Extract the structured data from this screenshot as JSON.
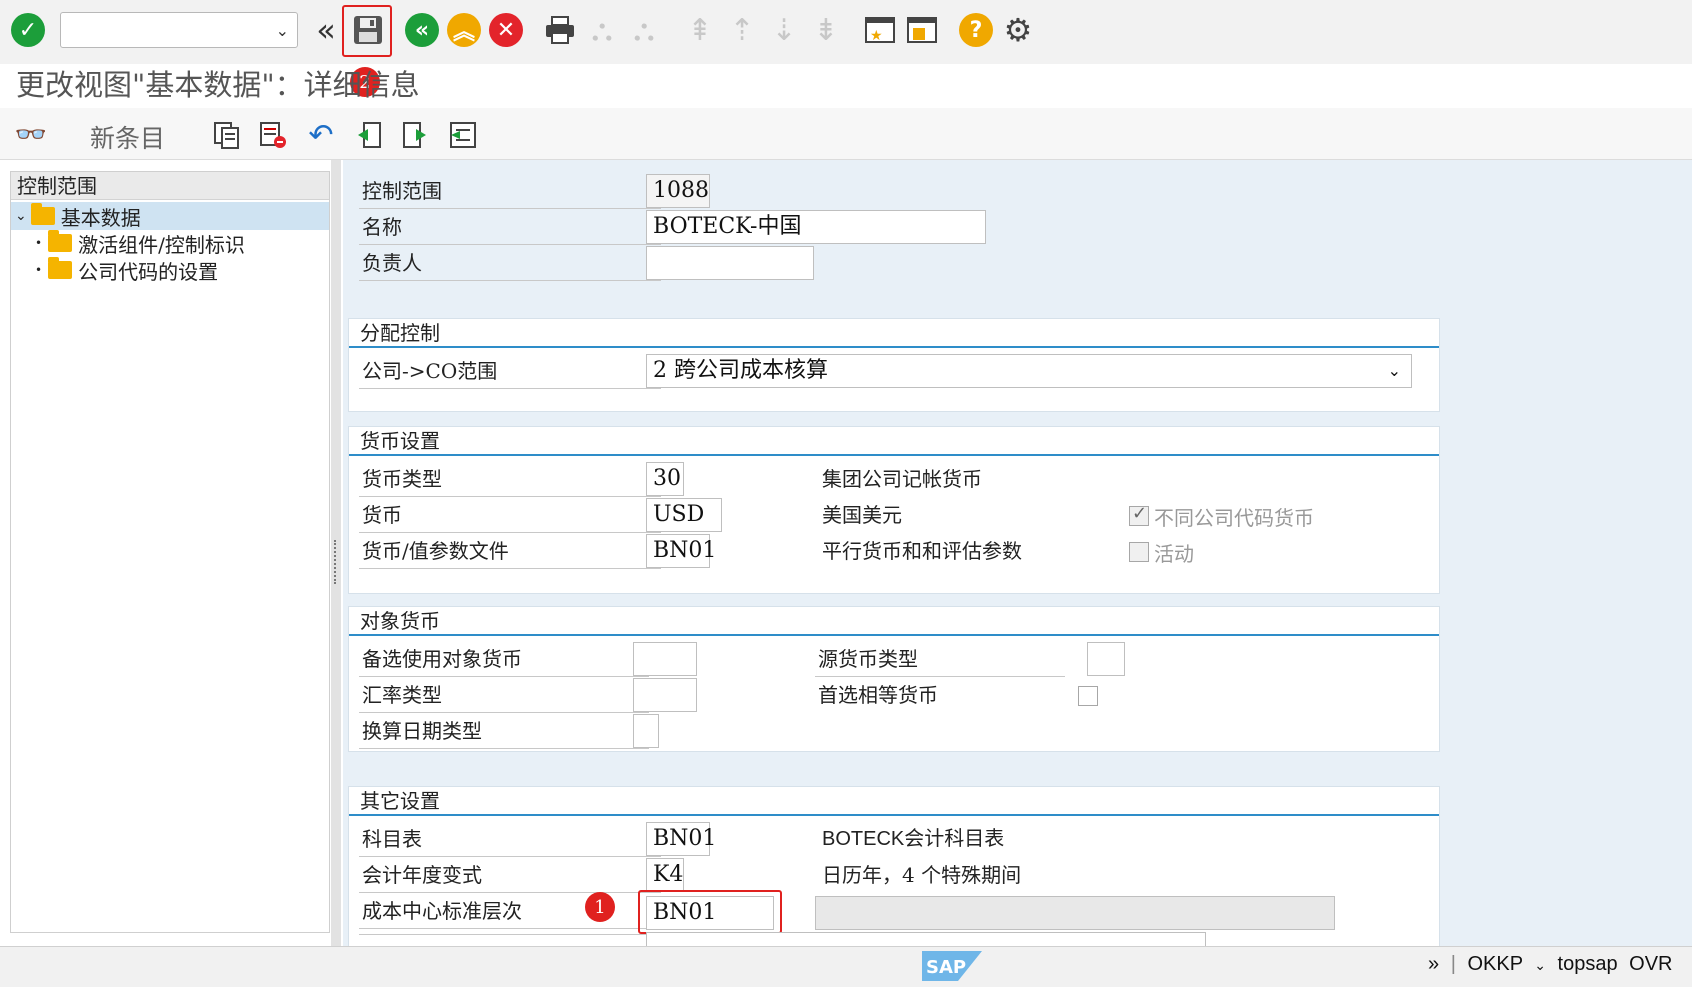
{
  "toolbar": {
    "command_field_value": "",
    "save_callout": "2"
  },
  "title": "更改视图\"基本数据\"：详细信息",
  "toolbar2": {
    "new_entries_label": "新条目"
  },
  "tree": {
    "header": "控制范围",
    "items": [
      {
        "label": "基本数据",
        "selected": true
      },
      {
        "label": "激活组件/控制标识"
      },
      {
        "label": "公司代码的设置"
      }
    ]
  },
  "form": {
    "controlling_area_label": "控制范围",
    "controlling_area_value": "1088",
    "name_label": "名称",
    "name_value": "BOTECK-中国",
    "person_resp_label": "负责人",
    "person_resp_value": "",
    "assignment_group": {
      "title": "分配控制",
      "company_co_label": "公司->CO范围",
      "company_co_value": "2 跨公司成本核算"
    },
    "currency_group": {
      "title": "货币设置",
      "currency_type_label": "货币类型",
      "currency_type_value": "30",
      "currency_type_text": "集团公司记帐货币",
      "currency_label": "货币",
      "currency_value": "USD",
      "currency_text": "美国美元",
      "diff_cc_currency_label": "不同公司代码货币",
      "diff_cc_currency_checked": true,
      "curr_val_profile_label": "货币/值参数文件",
      "curr_val_profile_value": "BN01",
      "curr_val_profile_text": "平行货币和和评估参数",
      "active_label": "活动",
      "active_checked": false
    },
    "object_currency_group": {
      "title": "对象货币",
      "alt_obj_currency_label": "备选使用对象货币",
      "alt_obj_currency_value": "",
      "source_currency_type_label": "源货币类型",
      "source_currency_type_value": "",
      "exchange_rate_type_label": "汇率类型",
      "exchange_rate_type_value": "",
      "preferred_equiv_currency_label": "首选相等货币",
      "preferred_equiv_currency_checked": false,
      "translation_date_type_label": "换算日期类型",
      "translation_date_type_value": ""
    },
    "other_group": {
      "title": "其它设置",
      "chart_of_accounts_label": "科目表",
      "chart_of_accounts_value": "BN01",
      "chart_of_accounts_text": "BOTECK会计科目表",
      "fiscal_year_variant_label": "会计年度变式",
      "fiscal_year_variant_value": "K4",
      "fiscal_year_variant_text": "日历年，4 个特殊期间",
      "cost_center_hierarchy_label": "成本中心标准层次",
      "cost_center_hierarchy_value": "BN01",
      "cost_center_hierarchy_text": "",
      "cost_center_callout": "1"
    }
  },
  "statusbar": {
    "nav_glyph": "»",
    "transaction": "OKKP",
    "system": "topsap",
    "mode": "OVR",
    "sap_logo_text": "SAP"
  },
  "colors": {
    "accent_blue": "#2e8dc9",
    "highlight_red": "#e0211f",
    "ok_green": "#1c9e3a",
    "cancel_red": "#e3242b",
    "help_orange": "#f0a800"
  }
}
